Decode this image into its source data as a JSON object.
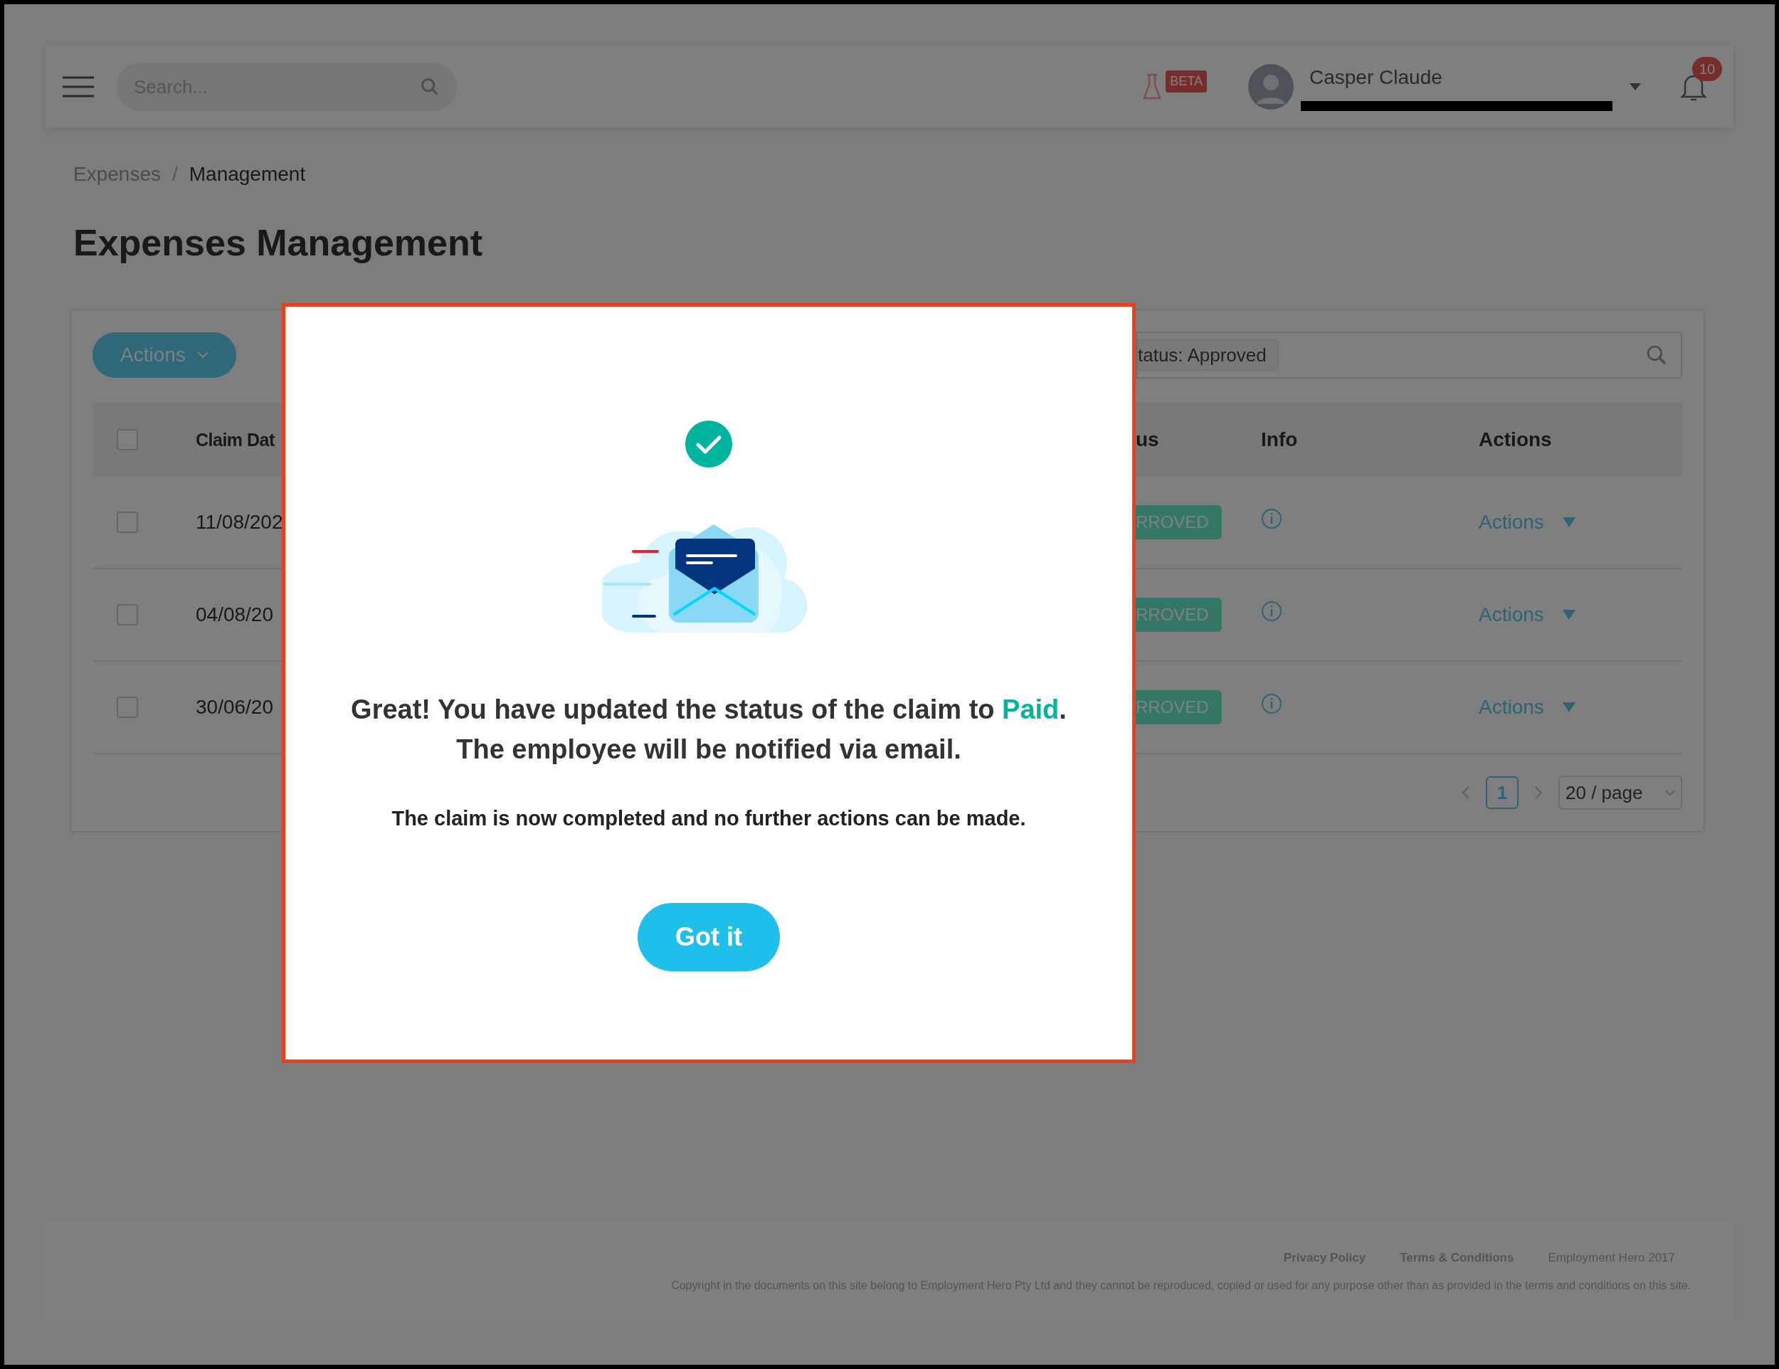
{
  "header": {
    "search": {
      "placeholder": "Search..."
    },
    "beta_badge": "BETA",
    "user": {
      "name": "Casper Claude"
    },
    "notifications": {
      "count": "10"
    }
  },
  "breadcrumb": {
    "separator": "/",
    "items": [
      {
        "label": "Expenses",
        "current": false
      },
      {
        "label": "Management",
        "current": true
      }
    ]
  },
  "page_title": "Expenses Management",
  "toolbar": {
    "actions_button": "Actions",
    "filter_tag": "tatus: Approved"
  },
  "table": {
    "select_all_checked": false,
    "columns": [
      "Claim Dat",
      "us",
      "Info",
      "Actions"
    ],
    "rows": [
      {
        "checked": false,
        "claim_date": "11/08/202",
        "status": "RROVED",
        "action": "Actions"
      },
      {
        "checked": false,
        "claim_date": "04/08/20",
        "status": "RROVED",
        "action": "Actions"
      },
      {
        "checked": false,
        "claim_date": "30/06/20",
        "status": "RROVED",
        "action": "Actions"
      }
    ]
  },
  "pagination": {
    "pages": [
      {
        "label": "1",
        "selected": true
      }
    ],
    "page_size": "20 / page"
  },
  "footer": {
    "links": [
      "Privacy Policy",
      "Terms & Conditions"
    ],
    "brand": "Employment Hero 2017",
    "copyright": "Copyright in the documents on this site belong to Employment Hero Pty Ltd and they cannot be reproduced, copied or used for any purpose other than as provided in the terms and conditions on this site."
  },
  "modal": {
    "heading_lead": "Great! You have updated the status of the claim to",
    "heading_highlight": "Paid",
    "heading_end": ".",
    "heading_line2": "The employee will be notified via email.",
    "note": "The claim is now completed and no further actions can be made.",
    "button": "Got it"
  }
}
